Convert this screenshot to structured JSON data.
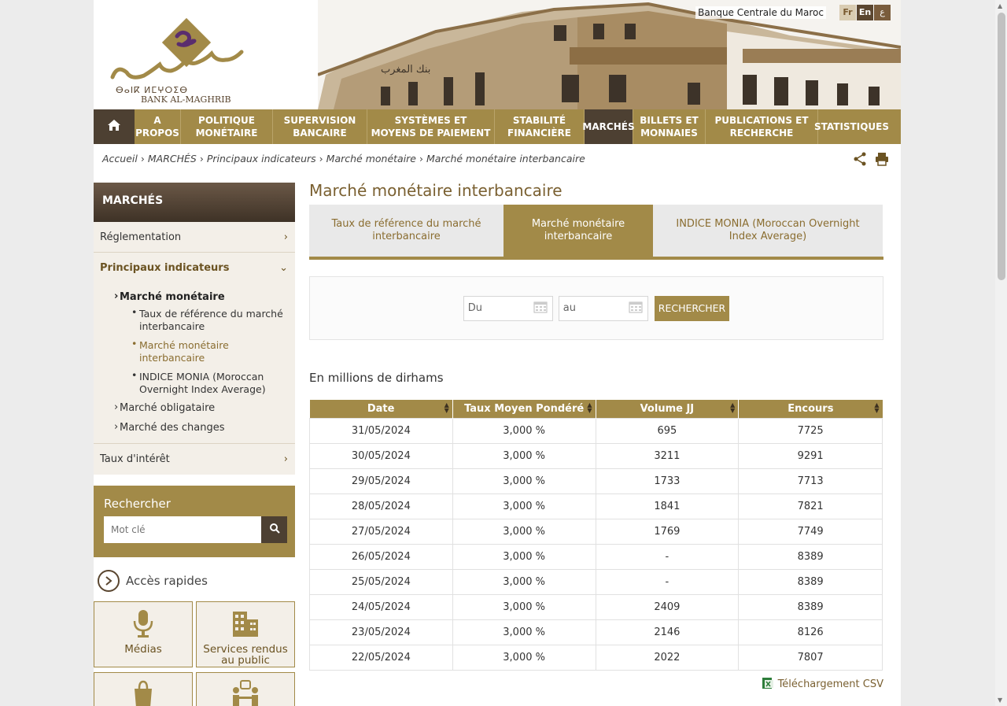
{
  "header": {
    "bank_name": "Banque Centrale du Maroc",
    "logo_text": "BANK AL-MAGHRIB",
    "languages": [
      "Fr",
      "En",
      "ع"
    ]
  },
  "nav": {
    "items": [
      {
        "label": "A PROPOS"
      },
      {
        "label": "POLITIQUE MONÉTAIRE"
      },
      {
        "label": "SUPERVISION BANCAIRE"
      },
      {
        "label": "SYSTÈMES ET MOYENS DE PAIEMENT"
      },
      {
        "label": "STABILITÉ FINANCIÈRE"
      },
      {
        "label": "MARCHÉS"
      },
      {
        "label": "BILLETS ET MONNAIES"
      },
      {
        "label": "PUBLICATIONS ET RECHERCHE"
      },
      {
        "label": "STATISTIQUES"
      }
    ]
  },
  "breadcrumb": [
    "Accueil",
    "MARCHÉS",
    "Principaux indicateurs",
    "Marché monétaire",
    "Marché monétaire interbancaire"
  ],
  "sidebar": {
    "title": "MARCHÉS",
    "reglementation": "Réglementation",
    "principaux": "Principaux indicateurs",
    "marche_monetaire": "Marché monétaire",
    "sub_items": [
      "Taux de référence du marché interbancaire",
      "Marché monétaire interbancaire",
      "INDICE MONIA (Moroccan Overnight Index Average)"
    ],
    "marche_obligataire": "Marché obligataire",
    "marche_changes": "Marché des changes",
    "taux_interet": "Taux d'intérêt",
    "search_title": "Rechercher",
    "search_placeholder": "Mot clé",
    "quick_access": "Accès rapides",
    "tiles": [
      "Médias",
      "Services rendus au public"
    ]
  },
  "main": {
    "title": "Marché monétaire interbancaire",
    "tabs": [
      "Taux de référence du marché interbancaire",
      "Marché monétaire interbancaire",
      "INDICE MONIA (Moroccan Overnight Index Average)"
    ],
    "date_from_placeholder": "Du",
    "date_to_placeholder": "au",
    "search_button": "RECHERCHER",
    "unit_label": "En millions de dirhams",
    "columns": [
      "Date",
      "Taux Moyen Pondéré",
      "Volume JJ",
      "Encours"
    ],
    "rows": [
      [
        "31/05/2024",
        "3,000 %",
        "695",
        "7725"
      ],
      [
        "30/05/2024",
        "3,000 %",
        "3211",
        "9291"
      ],
      [
        "29/05/2024",
        "3,000 %",
        "1733",
        "7713"
      ],
      [
        "28/05/2024",
        "3,000 %",
        "1841",
        "7821"
      ],
      [
        "27/05/2024",
        "3,000 %",
        "1769",
        "7749"
      ],
      [
        "26/05/2024",
        "3,000 %",
        "-",
        "8389"
      ],
      [
        "25/05/2024",
        "3,000 %",
        "-",
        "8389"
      ],
      [
        "24/05/2024",
        "3,000 %",
        "2409",
        "8389"
      ],
      [
        "23/05/2024",
        "3,000 %",
        "2146",
        "8126"
      ],
      [
        "22/05/2024",
        "3,000 %",
        "2022",
        "7807"
      ]
    ],
    "csv_label": "Téléchargement CSV"
  }
}
